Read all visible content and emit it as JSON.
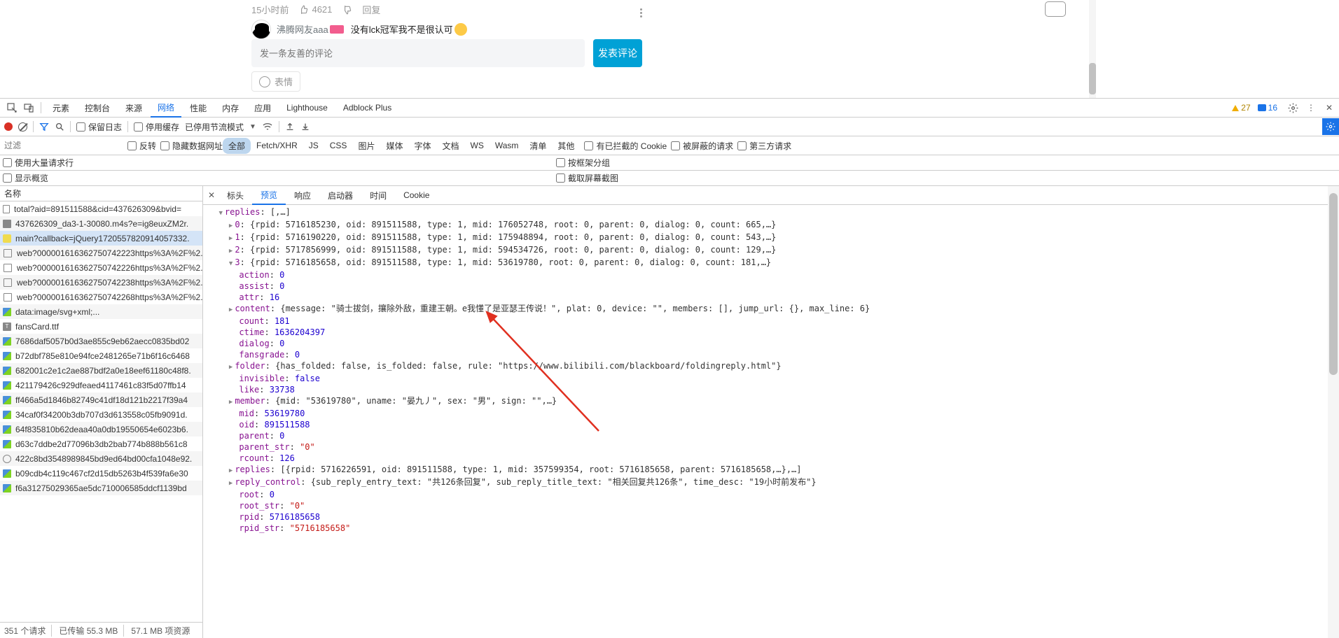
{
  "page": {
    "comment_time": "15小时前",
    "like_count": "4621",
    "reply_label": "回复",
    "reply_username": "沸腾网友aaa",
    "reply_text": "没有lck冠军我不是很认可",
    "input_placeholder": "发一条友善的评论",
    "publish_label": "发表评论",
    "emoji_label": "表情"
  },
  "devtools": {
    "tabs": [
      "元素",
      "控制台",
      "来源",
      "网络",
      "性能",
      "内存",
      "应用",
      "Lighthouse",
      "Adblock Plus"
    ],
    "active_tab": "网络",
    "warn_count": "27",
    "info_count": "16",
    "toolbar": {
      "preserve_log": "保留日志",
      "disable_cache": "停用缓存",
      "throttle": "已停用节流模式"
    },
    "filterbar": {
      "filter_placeholder": "过滤",
      "invert": "反转",
      "hide_data": "隐藏数据网址",
      "types": [
        "全部",
        "Fetch/XHR",
        "JS",
        "CSS",
        "图片",
        "媒体",
        "字体",
        "文档",
        "WS",
        "Wasm",
        "清单",
        "其他"
      ],
      "active_type": "全部",
      "blocked_cookie": "有已拦截的 Cookie",
      "blocked_req": "被屏蔽的请求",
      "third_party": "第三方请求"
    },
    "optrow": {
      "big_rows": "使用大量请求行",
      "show_overview": "显示概览",
      "group_by_frame": "按框架分组",
      "screenshots": "截取屏幕截图"
    },
    "sidebar": {
      "header": "名称",
      "requests": [
        {
          "icon": "doc",
          "name": "total?aid=891511588&cid=437626309&bvid="
        },
        {
          "icon": "media",
          "name": "437626309_da3-1-30080.m4s?e=ig8euxZM2r."
        },
        {
          "icon": "js",
          "name": "main?callback=jQuery1720557820914057332.",
          "selected": true
        },
        {
          "icon": "xhr",
          "name": "web?000001616362750742223https%3A%2F%2."
        },
        {
          "icon": "xhr",
          "name": "web?000001616362750742226https%3A%2F%2."
        },
        {
          "icon": "xhr",
          "name": "web?000001616362750742238https%3A%2F%2."
        },
        {
          "icon": "xhr",
          "name": "web?000001616362750742268https%3A%2F%2."
        },
        {
          "icon": "img",
          "name": "data:image/svg+xml;..."
        },
        {
          "icon": "font",
          "name": "fansCard.ttf"
        },
        {
          "icon": "img",
          "name": "7686daf5057b0d3ae855c9eb62aecc0835bd02"
        },
        {
          "icon": "img",
          "name": "b72dbf785e810e94fce2481265e71b6f16c6468"
        },
        {
          "icon": "img",
          "name": "682001c2e1c2ae887bdf2a0e18eef61180c48f8."
        },
        {
          "icon": "img",
          "name": "421179426c929dfeaed4117461c83f5d07ffb14"
        },
        {
          "icon": "img",
          "name": "ff466a5d1846b82749c41df18d121b2217f39a4"
        },
        {
          "icon": "img",
          "name": "34caf0f34200b3db707d3d613558c05fb9091d."
        },
        {
          "icon": "img",
          "name": "64f835810b62deaa40a0db19550654e6023b6."
        },
        {
          "icon": "img",
          "name": "d63c7ddbe2d77096b3db2bab774b888b561c8"
        },
        {
          "icon": "other",
          "name": "422c8bd3548989845bd9ed64bd00cfa1048e92."
        },
        {
          "icon": "img",
          "name": "b09cdb4c119c467cf2d15db5263b4f539fa6e30"
        },
        {
          "icon": "img",
          "name": "f6a31275029365ae5dc710006585ddcf1139bd"
        }
      ],
      "footer": {
        "count": "351 个请求",
        "transferred": "已传输 55.3 MB",
        "resources": "57.1 MB 项资源"
      }
    },
    "detail": {
      "tabs": [
        "标头",
        "预览",
        "响应",
        "启动器",
        "时间",
        "Cookie"
      ],
      "active_tab": "预览"
    }
  },
  "tree": {
    "replies_header": "replies: [,…]",
    "items": [
      {
        "idx": "0",
        "summary": "{rpid: 5716185230, oid: 891511588, type: 1, mid: 176052748, root: 0, parent: 0, dialog: 0, count: 665,…}"
      },
      {
        "idx": "1",
        "summary": "{rpid: 5716190220, oid: 891511588, type: 1, mid: 175948894, root: 0, parent: 0, dialog: 0, count: 543,…}"
      },
      {
        "idx": "2",
        "summary": "{rpid: 5717856999, oid: 891511588, type: 1, mid: 594534726, root: 0, parent: 0, dialog: 0, count: 129,…}"
      },
      {
        "idx": "3",
        "summary": "{rpid: 5716185658, oid: 891511588, type: 1, mid: 53619780, root: 0, parent: 0, dialog: 0, count: 181,…}"
      }
    ],
    "node3": {
      "action": "0",
      "assist": "0",
      "attr": "16",
      "content_summary": "{message: \"骑士拔剑，攘除外敌，重建王朝。e我懂了是亚瑟王传说！\", plat: 0, device: \"\", members: [], jump_url: {}, max_line: 6}",
      "count": "181",
      "ctime": "1636204397",
      "dialog": "0",
      "fansgrade": "0",
      "folder_summary": "{has_folded: false, is_folded: false, rule: \"https://www.bilibili.com/blackboard/foldingreply.html\"}",
      "invisible": "false",
      "like": "33738",
      "member_summary": "{mid: \"53619780\", uname: \"晏九丿\", sex: \"男\", sign: \"\",…}",
      "mid": "53619780",
      "oid": "891511588",
      "parent": "0",
      "parent_str": "\"0\"",
      "rcount": "126",
      "replies_summary": "[{rpid: 5716226591, oid: 891511588, type: 1, mid: 357599354, root: 5716185658, parent: 5716185658,…},…]",
      "reply_control_summary": "{sub_reply_entry_text: \"共126条回复\", sub_reply_title_text: \"相关回复共126条\", time_desc: \"19小时前发布\"}",
      "root": "0",
      "root_str": "\"0\"",
      "rpid": "5716185658",
      "rpid_str": "\"5716185658\""
    }
  }
}
